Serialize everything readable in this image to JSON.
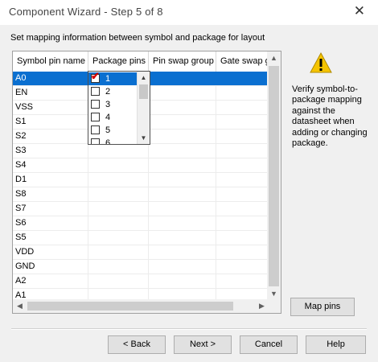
{
  "window": {
    "title": "Component Wizard - Step 5 of 8",
    "close_label": "✕"
  },
  "instruction": "Set mapping information between symbol and package for layout",
  "grid": {
    "columns": [
      "Symbol pin name",
      "Package pins",
      "Pin swap group",
      "Gate swap g"
    ],
    "rows": [
      "A0",
      "EN",
      "VSS",
      "S1",
      "S2",
      "S3",
      "S4",
      "D1",
      "S8",
      "S7",
      "S6",
      "S5",
      "VDD",
      "GND",
      "A2",
      "A1"
    ],
    "selected_row": "A0"
  },
  "package_pins_dropdown": {
    "items": [
      {
        "label": "1",
        "checked": true
      },
      {
        "label": "2",
        "checked": false
      },
      {
        "label": "3",
        "checked": false
      },
      {
        "label": "4",
        "checked": false
      },
      {
        "label": "5",
        "checked": false
      },
      {
        "label": "6",
        "checked": false
      }
    ],
    "selected": "1"
  },
  "help": {
    "icon": "warning-icon",
    "text": "Verify symbol-to-package mapping against the datasheet when adding or changing package."
  },
  "buttons": {
    "map_pins": "Map pins",
    "back": "< Back",
    "next": "Next >",
    "cancel": "Cancel",
    "help": "Help"
  },
  "colors": {
    "selection": "#0a6fd0",
    "check": "#d40000",
    "warning": "#f5c400"
  }
}
